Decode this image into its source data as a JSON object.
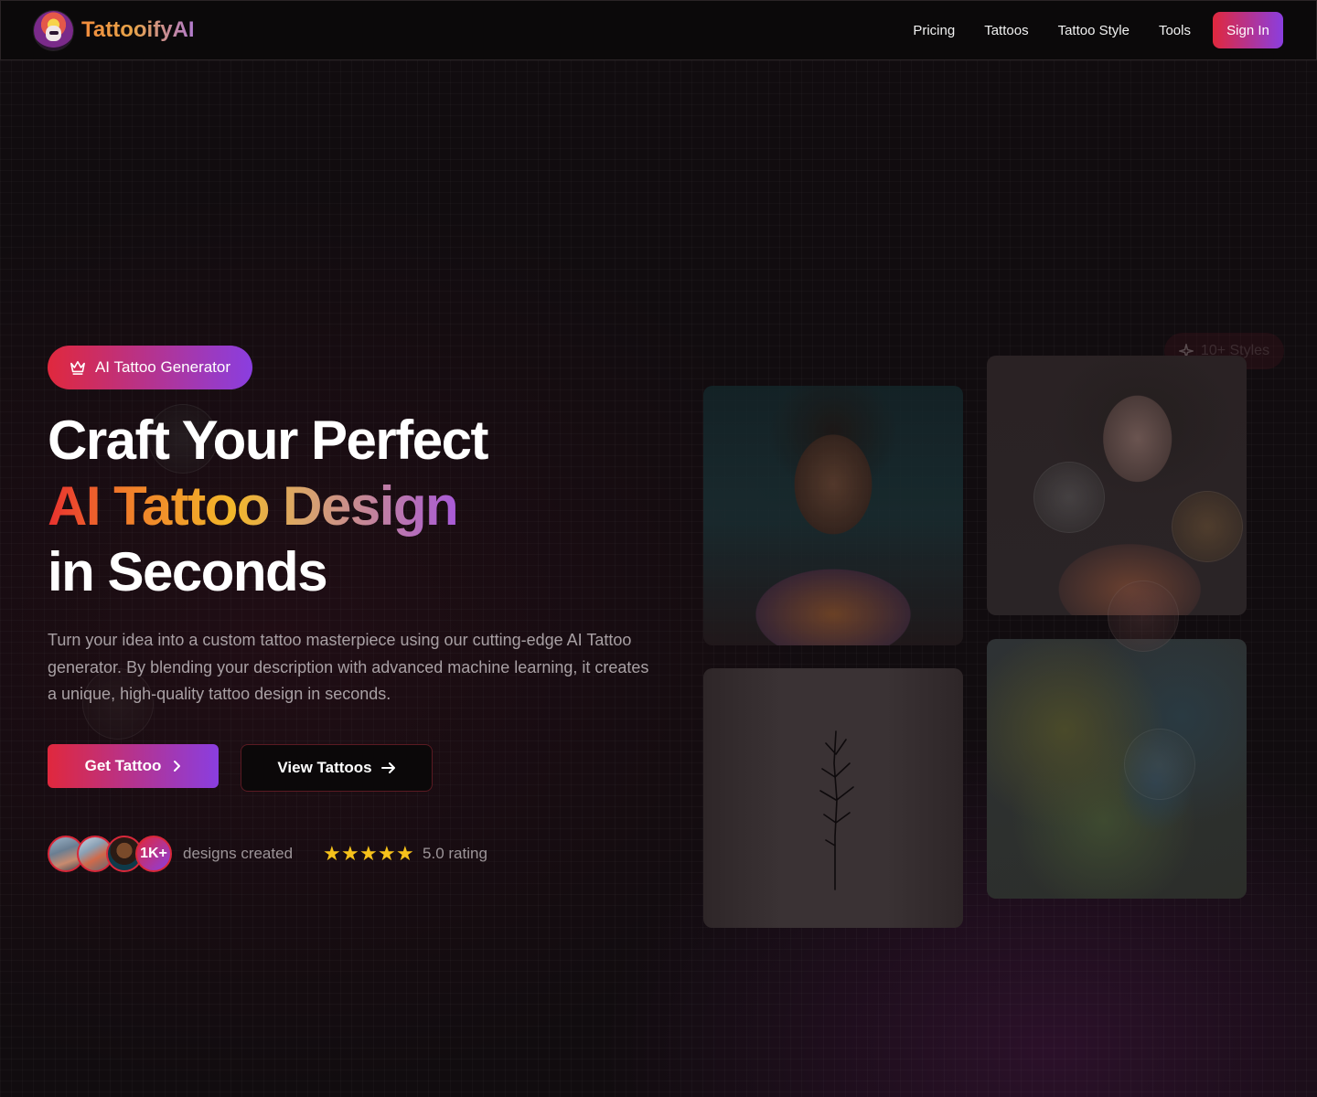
{
  "brand": {
    "name": "TattooifyAI"
  },
  "nav": {
    "links": [
      "Pricing",
      "Tattoos",
      "Tattoo Style",
      "Tools"
    ],
    "signin": "Sign In"
  },
  "hero": {
    "badge": "AI Tattoo Generator",
    "headline": {
      "line1": "Craft Your Perfect",
      "line2": "AI Tattoo Design",
      "line3": "in Seconds"
    },
    "description": "Turn your idea into a custom tattoo masterpiece using our cutting-edge AI Tattoo generator. By blending your description with advanced machine learning, it creates a unique, high-quality tattoo design in seconds.",
    "primary_button": "Get Tattoo",
    "secondary_button": "View Tattoos",
    "social": {
      "count": "1K+",
      "label": "designs created",
      "rating": "5.0 rating",
      "stars": 5
    },
    "styles_badge": "10+ Styles"
  },
  "colors": {
    "accent_start": "#e0283d",
    "accent_end": "#8a3ee0",
    "star": "#f6c21b"
  },
  "icons": {
    "badge": "crown-icon",
    "primary_button": "chevron-right-icon",
    "secondary_button": "arrow-right-icon",
    "styles_badge": "sparkle-icon"
  }
}
